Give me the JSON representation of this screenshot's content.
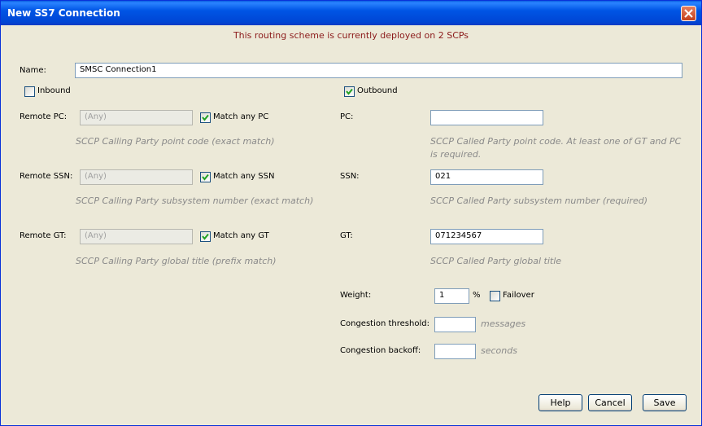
{
  "window": {
    "title": "New SS7 Connection"
  },
  "notice": "This routing scheme is currently deployed on 2 SCPs",
  "name": {
    "label": "Name:",
    "value": "SMSC Connection1"
  },
  "inbound": {
    "label": "Inbound",
    "checked": false
  },
  "outbound": {
    "label": "Outbound",
    "checked": true
  },
  "remote": {
    "pc": {
      "label": "Remote PC:",
      "placeholder": "(Any)",
      "match_label": "Match any PC",
      "match_checked": true,
      "help": "SCCP Calling Party point code (exact match)"
    },
    "ssn": {
      "label": "Remote SSN:",
      "placeholder": "(Any)",
      "match_label": "Match any SSN",
      "match_checked": true,
      "help": "SCCP Calling Party subsystem number (exact match)"
    },
    "gt": {
      "label": "Remote GT:",
      "placeholder": "(Any)",
      "match_label": "Match any GT",
      "match_checked": true,
      "help": "SCCP Calling Party global title (prefix match)"
    }
  },
  "local": {
    "pc": {
      "label": "PC:",
      "value": "",
      "help_line1": "SCCP Called Party point code. At least one of GT and PC",
      "help_line2": "is required."
    },
    "ssn": {
      "label": "SSN:",
      "value": "021",
      "help": "SCCP Called Party subsystem number (required)"
    },
    "gt": {
      "label": "GT:",
      "value": "071234567",
      "help": "SCCP Called Party global title"
    }
  },
  "weight": {
    "label": "Weight:",
    "value": "1",
    "unit": "%"
  },
  "failover": {
    "label": "Failover",
    "checked": false
  },
  "congestion_threshold": {
    "label": "Congestion threshold:",
    "value": "",
    "unit": "messages"
  },
  "congestion_backoff": {
    "label": "Congestion backoff:",
    "value": "",
    "unit": "seconds"
  },
  "buttons": {
    "help": "Help",
    "cancel": "Cancel",
    "save": "Save"
  },
  "colors": {
    "title_bar": "#0055e5",
    "notice": "#8b1a1a",
    "dialog_bg": "#ece9d8",
    "help_text": "#8a8a8a"
  }
}
